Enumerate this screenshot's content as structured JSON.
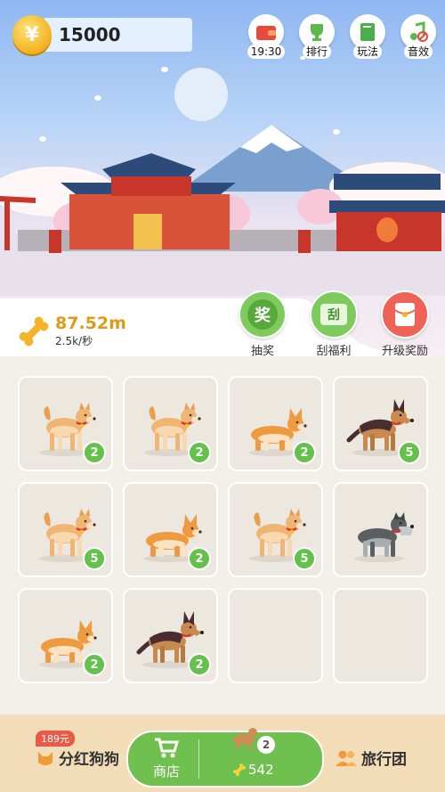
{
  "hud": {
    "coins": "15000",
    "coin_symbol": "¥"
  },
  "top_buttons": [
    {
      "label": "19:30",
      "icon": "wallet-icon"
    },
    {
      "label": "排行",
      "icon": "trophy-icon"
    },
    {
      "label": "玩法",
      "icon": "book-icon"
    },
    {
      "label": "音效",
      "icon": "music-muted-icon"
    }
  ],
  "bone": {
    "value": "87.52m",
    "rate": "2.5k/秒"
  },
  "actions": [
    {
      "label": "抽奖",
      "icon_text": "奖",
      "icon": "lottery-icon"
    },
    {
      "label": "刮福利",
      "icon_text": "刮",
      "icon": "scratch-card-icon"
    },
    {
      "label": "升级奖励",
      "icon": "red-envelope-icon"
    }
  ],
  "grid": [
    {
      "dog": "shiba",
      "level": "2"
    },
    {
      "dog": "shiba",
      "level": "2"
    },
    {
      "dog": "corgi",
      "level": "2"
    },
    {
      "dog": "shepherd",
      "level": "5"
    },
    {
      "dog": "shiba",
      "level": "5"
    },
    {
      "dog": "corgi",
      "level": "2"
    },
    {
      "dog": "shiba",
      "level": "5"
    },
    {
      "dog": "schnauzer",
      "level": ""
    },
    {
      "dog": "corgi",
      "level": "2"
    },
    {
      "dog": "shepherd",
      "level": "2"
    },
    {
      "dog": "",
      "level": ""
    },
    {
      "dog": "",
      "level": ""
    }
  ],
  "bottom": {
    "dividend_price": "189元",
    "dividend_label": "分红狗狗",
    "shop_label": "商店",
    "buy_level": "2",
    "buy_cost": "542",
    "travel_label": "旅行团"
  },
  "colors": {
    "accent_green": "#6fc04f",
    "gold": "#f4b21d",
    "red": "#ef6256"
  }
}
